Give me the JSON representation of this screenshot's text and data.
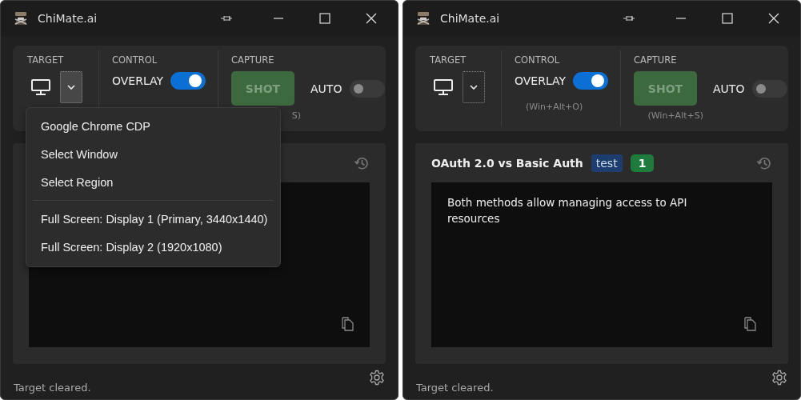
{
  "windows": [
    {
      "title": "ChiMate.ai",
      "target": {
        "label": "TARGET",
        "dropdown_open": true
      },
      "control": {
        "label": "CONTROL",
        "toggle_label": "OVERLAY",
        "on": true
      },
      "capture": {
        "label": "CAPTURE",
        "button": "SHOT",
        "hint": "S)",
        "auto_label": "AUTO",
        "auto_on": false
      },
      "menu": {
        "groups": [
          [
            "Google Chrome CDP",
            "Select Window",
            "Select Region"
          ],
          [
            "Full Screen: Display 1 (Primary, 3440x1440)",
            "Full Screen: Display 2 (1920x1080)"
          ]
        ]
      },
      "status": "Target cleared."
    },
    {
      "title": "ChiMate.ai",
      "target": {
        "label": "TARGET",
        "dropdown_open": false
      },
      "control": {
        "label": "CONTROL",
        "toggle_label": "OVERLAY",
        "on": true,
        "hint": "(Win+Alt+O)"
      },
      "capture": {
        "label": "CAPTURE",
        "button": "SHOT",
        "hint": "(Win+Alt+S)",
        "auto_label": "AUTO",
        "auto_on": false
      },
      "card": {
        "title": "OAuth 2.0 vs Basic Auth",
        "tags": [
          {
            "text": "test",
            "color": "#1c3d6e"
          },
          {
            "text": "1",
            "color": "#1f7a3e"
          }
        ],
        "body": "Both methods allow managing access to API resources"
      },
      "status": "Target cleared."
    }
  ]
}
